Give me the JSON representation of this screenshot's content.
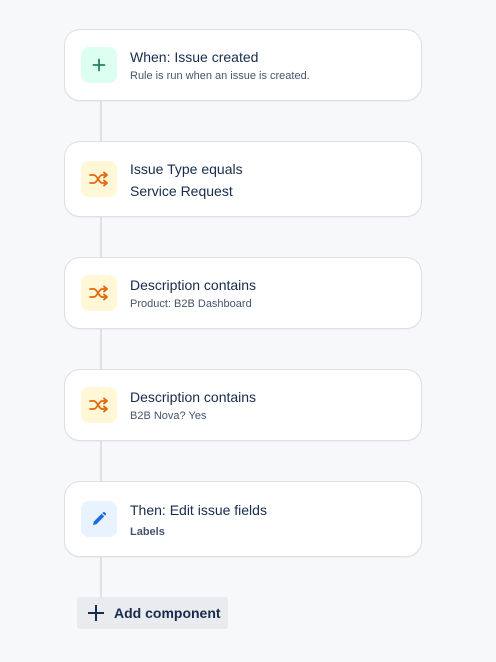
{
  "colors": {
    "trigger_accent": "#1f845a",
    "condition_accent": "#e2690f",
    "action_accent": "#1d6ae5"
  },
  "components": [
    {
      "kind": "trigger",
      "icon": "plus-icon",
      "title": "When: Issue created",
      "subtitle": "Rule is run when an issue is created."
    },
    {
      "kind": "condition",
      "icon": "shuffle-icon",
      "title": "Issue Type equals",
      "subtitle": "Service Request"
    },
    {
      "kind": "condition",
      "icon": "shuffle-icon",
      "title": "Description contains",
      "subtitle": "Product: B2B Dashboard"
    },
    {
      "kind": "condition",
      "icon": "shuffle-icon",
      "title": "Description contains",
      "subtitle": "B2B Nova? Yes"
    },
    {
      "kind": "action",
      "icon": "pencil-icon",
      "title": "Then: Edit issue fields",
      "subtitle": "Labels"
    }
  ],
  "add_component": {
    "icon": "plus-icon",
    "label": "Add component"
  }
}
